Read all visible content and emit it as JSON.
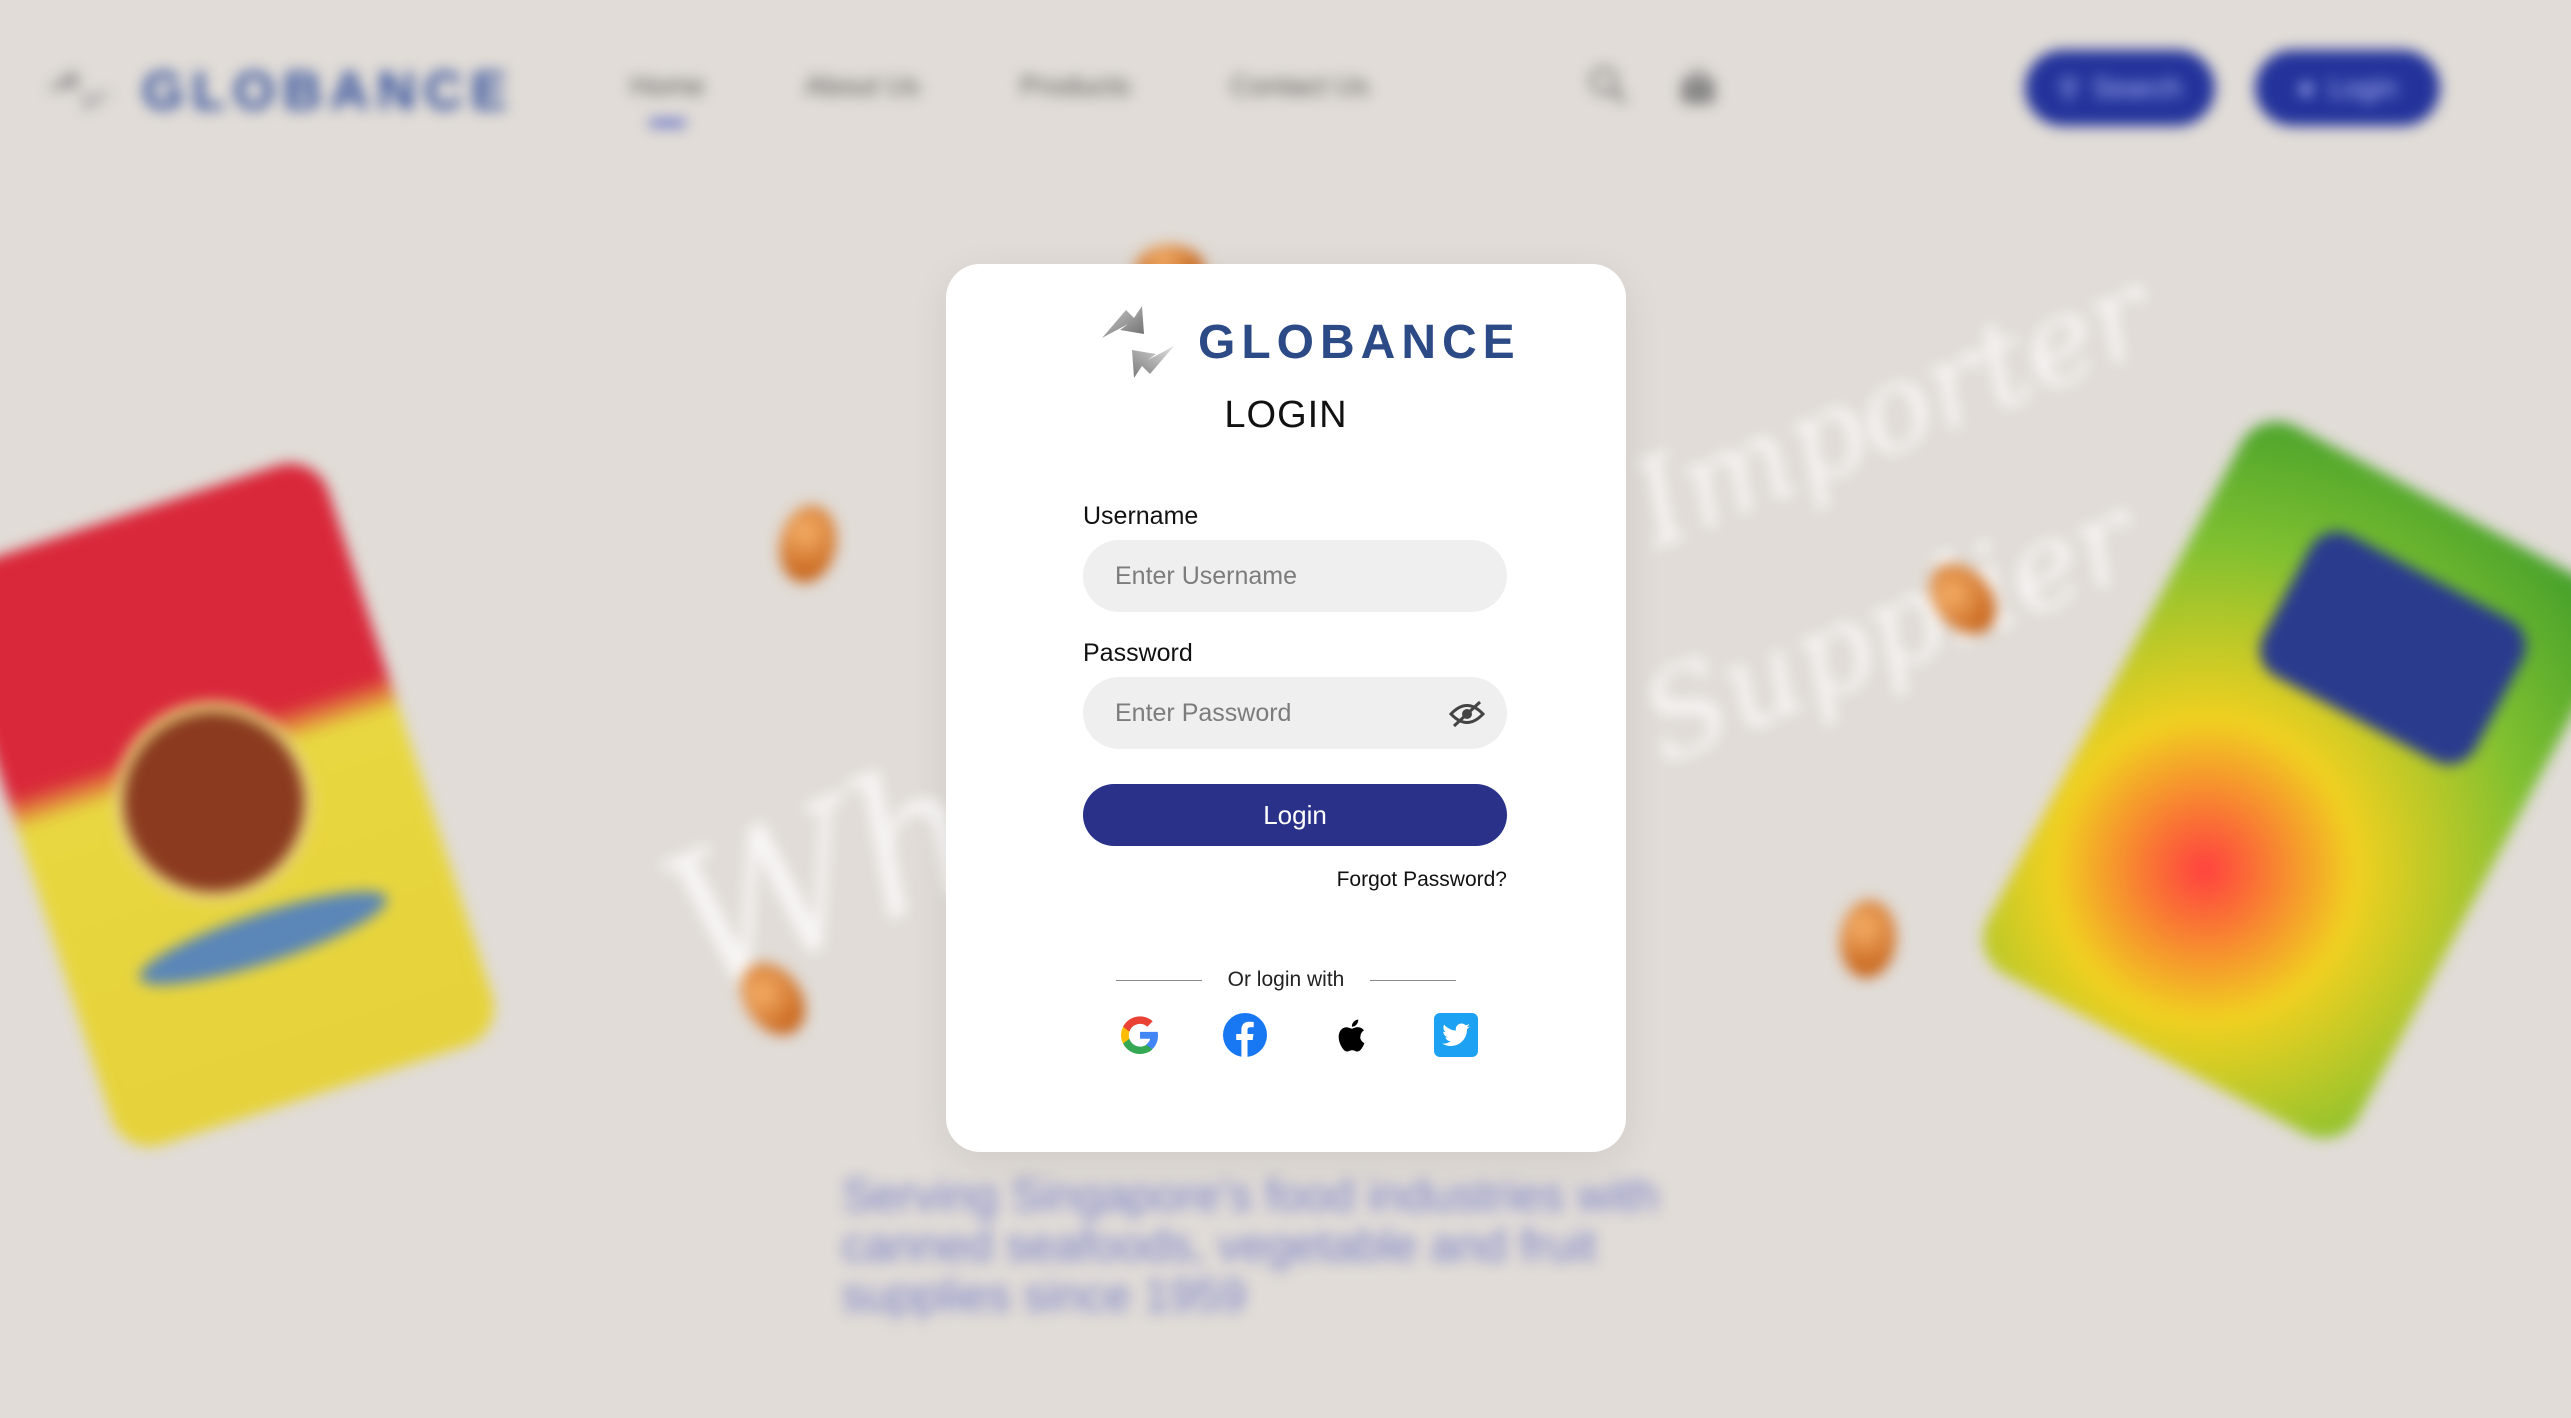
{
  "background": {
    "logo_text": "GLOBANCE",
    "nav": [
      "Home",
      "About Us",
      "Products",
      "Contact Us"
    ],
    "search_label": "Search",
    "user_label": "Login",
    "tagline": "Serving Singapore's food industries with canned seafoods, vegetable and fruit supplies since 1959",
    "script_words": [
      "Wholesale",
      "Importer",
      "Supplier"
    ]
  },
  "login": {
    "brand": "GLOBANCE",
    "title": "LOGIN",
    "username_label": "Username",
    "username_placeholder": "Enter Username",
    "password_label": "Password",
    "password_placeholder": "Enter Password",
    "submit_label": "Login",
    "forgot_label": "Forgot Password?",
    "divider_text": "Or login with"
  },
  "colors": {
    "primary_button": "#293188",
    "brand_text": "#2c4a86",
    "page_background": "#e1dcd7"
  },
  "social_providers": [
    "google-icon",
    "facebook-icon",
    "apple-icon",
    "twitter-icon"
  ]
}
